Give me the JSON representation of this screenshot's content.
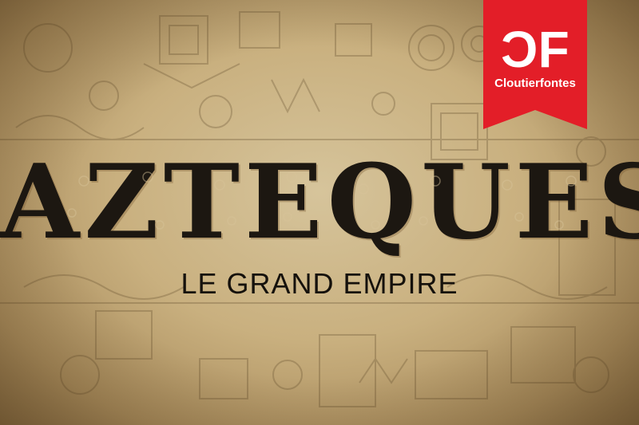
{
  "poster": {
    "title": "AZTEQUES",
    "subtitle": "LE GRAND EMPIRE"
  },
  "brand": {
    "logo_left": "C",
    "logo_right": "F",
    "name": "Cloutierfontes",
    "color": "#e31e28"
  },
  "colors": {
    "parchment": "#c9b07f",
    "ink": "#1c1711"
  }
}
